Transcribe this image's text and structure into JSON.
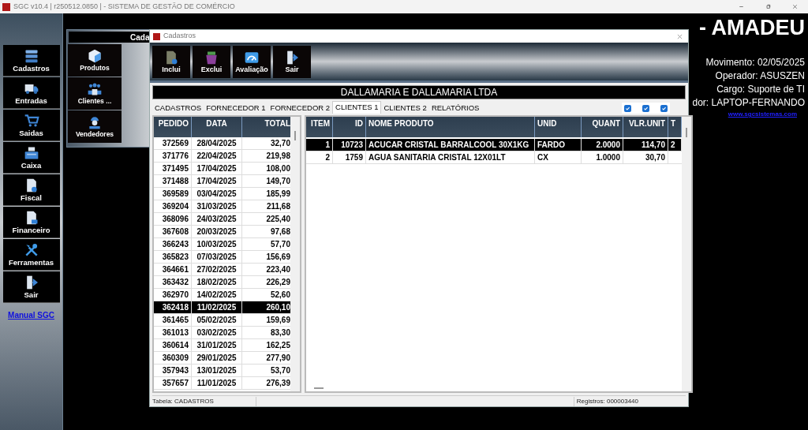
{
  "window": {
    "title": "SGC v10.4 | r250512.0850 | - SISTEMA DE GESTÃO DE COMÉRCIO"
  },
  "sidebar": {
    "items": [
      "Cadastros",
      "Entradas",
      "Saidas",
      "Caixa",
      "Fiscal",
      "Financeiro",
      "Ferramentas",
      "Sair"
    ],
    "link": "Manual SGC"
  },
  "header": {
    "title": "- AMADEU",
    "info": [
      "Movimento: 02/05/2025",
      "Operador: ASUSZEN",
      "Cargo: Suporte de TI",
      "dor: LAPTOP-FERNANDO"
    ],
    "link": "www.sgcsistemas.com"
  },
  "submenu": {
    "heading": "Cada",
    "items": [
      "Produtos",
      "Clientes ...",
      "Vendedores"
    ]
  },
  "dialog": {
    "title": "Cadastros",
    "toolbar": [
      "Inclui",
      "Exclui",
      "Avaliação",
      "Sair"
    ],
    "company": "DALLAMARIA E DALLAMARIA LTDA",
    "tabs": [
      {
        "label": "CADASTROS",
        "selected": false
      },
      {
        "label": "FORNECEDOR 1",
        "selected": false
      },
      {
        "label": "FORNECEDOR 2",
        "selected": false
      },
      {
        "label": "CLIENTES 1",
        "selected": true
      },
      {
        "label": "CLIENTES 2",
        "selected": false
      },
      {
        "label": "RELATÓRIOS",
        "selected": false
      }
    ],
    "checkboxes": [
      {
        "checked": true
      },
      {
        "checked": true
      },
      {
        "checked": true
      }
    ],
    "orders": {
      "columns": [
        "PEDIDO",
        "DATA",
        "TOTAL"
      ],
      "rows": [
        {
          "cells": [
            "372569",
            "28/04/2025",
            "32,70"
          ],
          "selected": false
        },
        {
          "cells": [
            "371776",
            "22/04/2025",
            "219,98"
          ],
          "selected": false
        },
        {
          "cells": [
            "371495",
            "17/04/2025",
            "108,00"
          ],
          "selected": false
        },
        {
          "cells": [
            "371488",
            "17/04/2025",
            "149,70"
          ],
          "selected": false
        },
        {
          "cells": [
            "369589",
            "03/04/2025",
            "185,99"
          ],
          "selected": false
        },
        {
          "cells": [
            "369204",
            "31/03/2025",
            "211,68"
          ],
          "selected": false
        },
        {
          "cells": [
            "368096",
            "24/03/2025",
            "225,40"
          ],
          "selected": false
        },
        {
          "cells": [
            "367608",
            "20/03/2025",
            "97,68"
          ],
          "selected": false
        },
        {
          "cells": [
            "366243",
            "10/03/2025",
            "57,70"
          ],
          "selected": false
        },
        {
          "cells": [
            "365823",
            "07/03/2025",
            "156,69"
          ],
          "selected": false
        },
        {
          "cells": [
            "364661",
            "27/02/2025",
            "223,40"
          ],
          "selected": false
        },
        {
          "cells": [
            "363432",
            "18/02/2025",
            "226,29"
          ],
          "selected": false
        },
        {
          "cells": [
            "362970",
            "14/02/2025",
            "52,60"
          ],
          "selected": false
        },
        {
          "cells": [
            "362418",
            "11/02/2025",
            "260,10"
          ],
          "selected": true
        },
        {
          "cells": [
            "361465",
            "05/02/2025",
            "159,69"
          ],
          "selected": false
        },
        {
          "cells": [
            "361013",
            "03/02/2025",
            "83,30"
          ],
          "selected": false
        },
        {
          "cells": [
            "360614",
            "31/01/2025",
            "162,25"
          ],
          "selected": false
        },
        {
          "cells": [
            "360309",
            "29/01/2025",
            "277,90"
          ],
          "selected": false
        },
        {
          "cells": [
            "357943",
            "13/01/2025",
            "53,70"
          ],
          "selected": false
        },
        {
          "cells": [
            "357657",
            "11/01/2025",
            "276,39"
          ],
          "selected": false
        }
      ]
    },
    "items": {
      "columns": [
        "ITEM",
        "ID",
        "NOME PRODUTO",
        "UNID",
        "QUANT",
        "VLR.UNIT",
        "T"
      ],
      "rows": [
        {
          "cells": [
            "1",
            "10723",
            "ACUCAR CRISTAL BARRALCOOL  30X1KG",
            "FARDO",
            "2.0000",
            "114,70",
            "2"
          ],
          "selected": true
        },
        {
          "cells": [
            "2",
            "1759",
            "AGUA SANITARIA CRISTAL 12X01LT",
            "CX",
            "1.0000",
            "30,70"
          ],
          "selected": false
        }
      ]
    },
    "status_bar": {
      "left": "Tabela: CADASTROS",
      "right": "Registros: 000003440"
    }
  }
}
